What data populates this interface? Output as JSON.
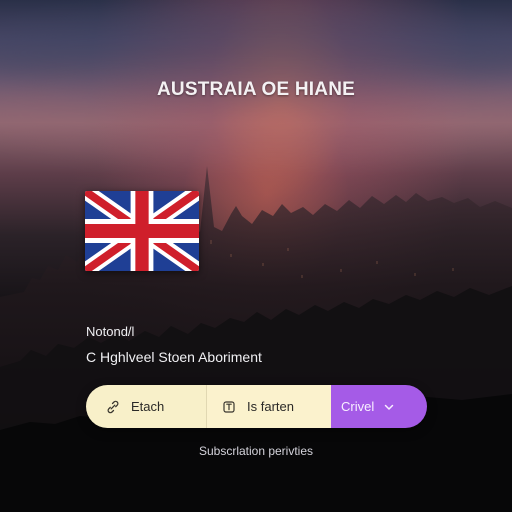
{
  "header": {
    "title": "AUSTRAIA OE HIANE"
  },
  "hero": {
    "flag_icon": "uk-flag-icon"
  },
  "details": {
    "small_label": "Notond/l",
    "medium_label": "C Hghlveel Stoen Aboriment"
  },
  "actions": {
    "segment_1": {
      "icon": "link-icon",
      "label": "Etach"
    },
    "segment_2": {
      "icon": "tag-icon",
      "label": "Is farten"
    },
    "segment_3": {
      "label": "Crivel",
      "icon": "chevron-down-icon"
    }
  },
  "footer": {
    "text": "Subscrlation perivties"
  },
  "colors": {
    "pill_light": "#f8f0c9",
    "pill_purple": "#a55be7",
    "title": "#f4f1f3"
  }
}
